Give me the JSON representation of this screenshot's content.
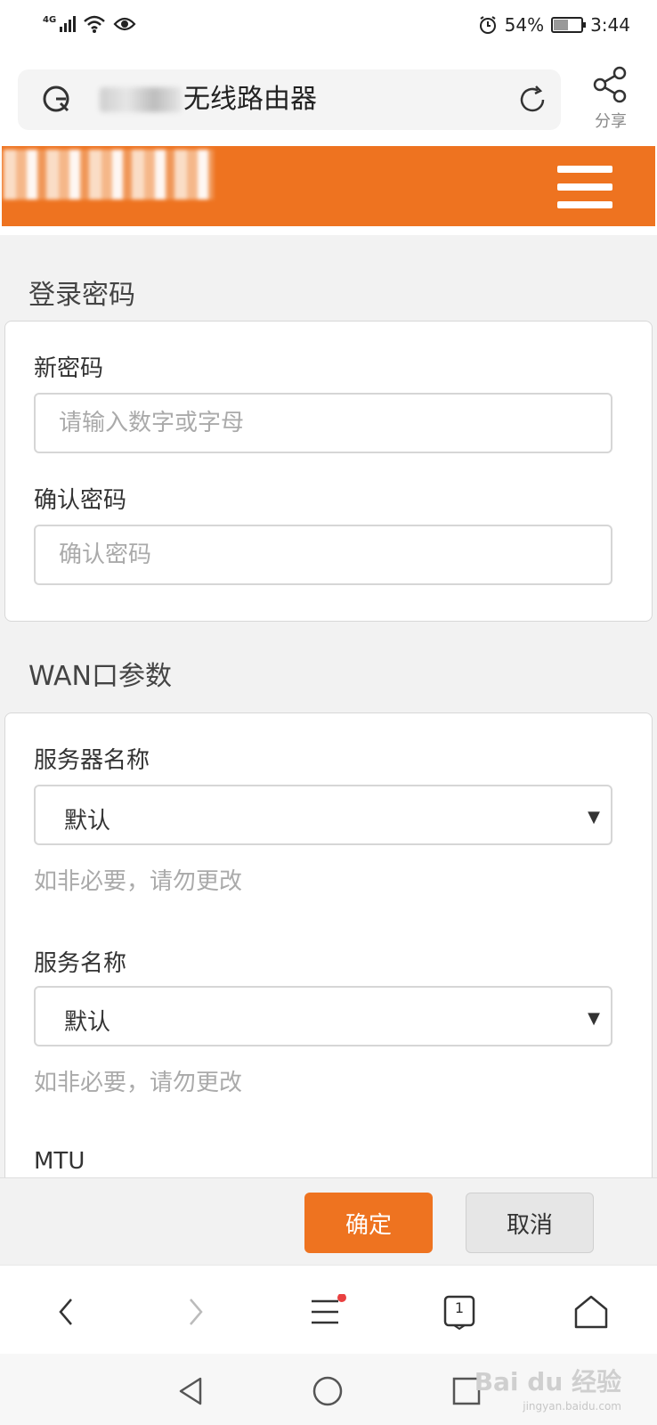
{
  "status_bar": {
    "network": "4G",
    "battery_percent": "54%",
    "battery_level": 0.54,
    "time": "3:44",
    "icons": [
      "signal-icon",
      "wifi-icon",
      "eye-icon",
      "alarm-icon",
      "battery-icon"
    ]
  },
  "browser": {
    "address_text": "无线路由器",
    "share_label": "分享"
  },
  "colors": {
    "accent": "#ee7320",
    "background": "#f2f2f2"
  },
  "login_section": {
    "title": "登录密码",
    "new_password_label": "新密码",
    "new_password_placeholder": "请输入数字或字母",
    "confirm_password_label": "确认密码",
    "confirm_password_placeholder": "确认密码"
  },
  "wan_section": {
    "title": "WAN口参数",
    "server_name_label": "服务器名称",
    "server_name_value": "默认",
    "server_name_hint": "如非必要，请勿更改",
    "service_name_label": "服务名称",
    "service_name_value": "默认",
    "service_name_hint": "如非必要，请勿更改",
    "mtu_label": "MTU"
  },
  "actions": {
    "confirm": "确定",
    "cancel": "取消"
  },
  "toolbar": {
    "tab_count": "1"
  },
  "watermark": {
    "text": "Bai du 经验",
    "sub": "jingyan.baidu.com"
  }
}
